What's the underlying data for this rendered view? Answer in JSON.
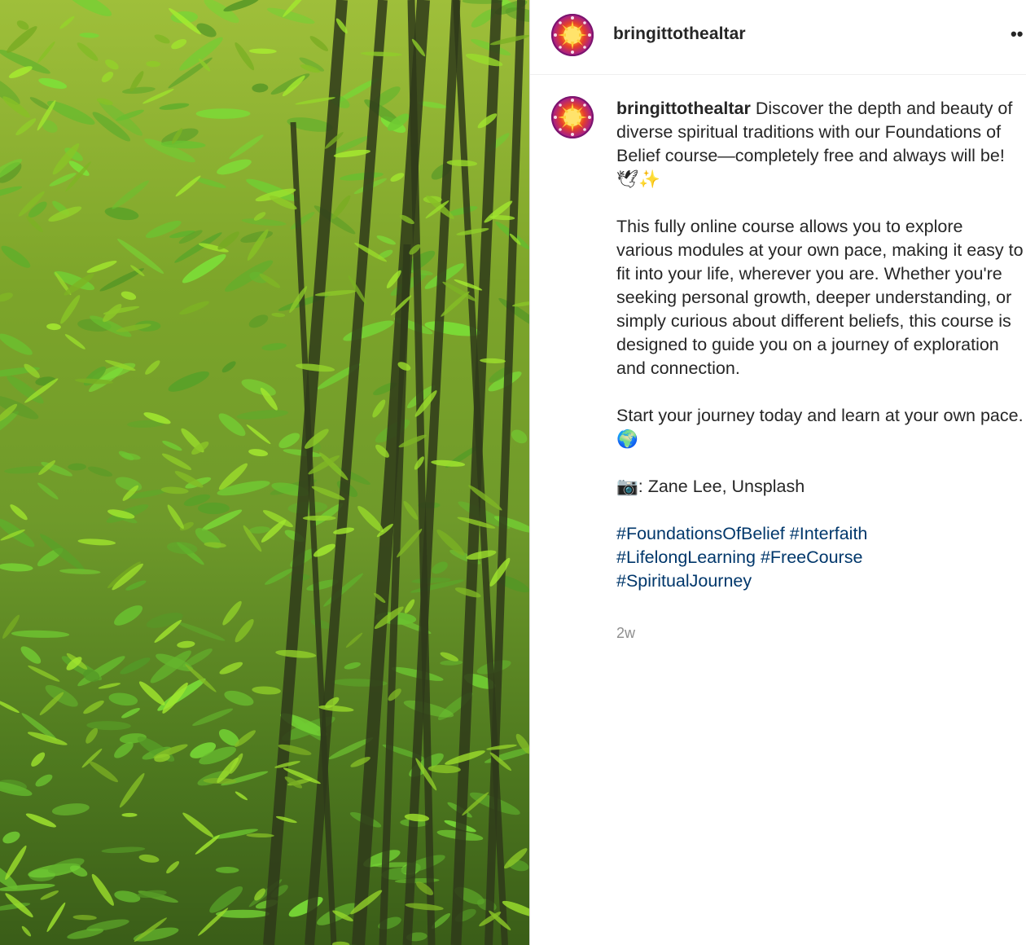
{
  "post": {
    "username": "bringittothealtar",
    "more_icon_glyph": "••",
    "caption": {
      "intro": "Discover the depth and beauty of diverse spiritual traditions with our Foundations of Belief course—completely free and always will be! 🕊✨",
      "paragraph_2": "This fully online course allows you to explore various modules at your own pace, making it easy to fit into your life, wherever you are. Whether you're seeking personal growth, deeper understanding, or simply curious about different beliefs, this course is designed to guide you on a journey of exploration and connection.",
      "paragraph_3": "Start your journey today and learn at your own pace.🌍",
      "credit": "📷: Zane Lee, Unsplash",
      "hashtags": [
        "#FoundationsOfBelief",
        "#Interfaith",
        "#LifelongLearning",
        "#FreeCourse",
        "#SpiritualJourney"
      ]
    },
    "timestamp": "2w"
  },
  "icons": {
    "avatar": "interfaith-symbols-sun-avatar",
    "more": "more-options-icon",
    "photo": "bamboo-forest-photo"
  },
  "colors": {
    "hashtag": "#00376b",
    "text": "#262626",
    "muted": "#8e8e8e",
    "avatar_ring": "#8a1a78",
    "avatar_sun": "#ffd84a"
  }
}
